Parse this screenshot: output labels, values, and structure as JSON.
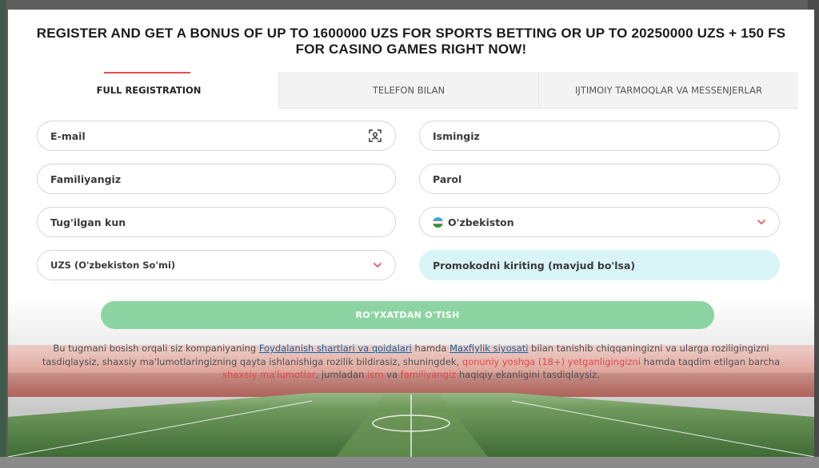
{
  "modal": {
    "title": "REGISTER AND GET A BONUS OF UP TO 1600000 UZS FOR SPORTS BETTING OR UP TO 20250000 UZS + 150 FS FOR CASINO GAMES RIGHT NOW!"
  },
  "tabs": [
    {
      "label": "FULL REGISTRATION",
      "active": true
    },
    {
      "label": "TELEFON BILAN",
      "active": false
    },
    {
      "label": "IJTIMOIY TARMOQLAR VA MESSENJERLAR",
      "active": false
    }
  ],
  "form": {
    "email_placeholder": "E-mail",
    "first_name_placeholder": "Ismingiz",
    "last_name_placeholder": "Familiyangiz",
    "password_placeholder": "Parol",
    "birthday_placeholder": "Tug'ilgan kun",
    "country_value": "O'zbekiston",
    "currency_value": "UZS (O'zbekiston So'mi)",
    "promo_placeholder": "Promokodni kiriting (mavjud bo'lsa)",
    "submit_label": "RO'YXATDAN O'TISH"
  },
  "legal": {
    "p1": "Bu tugmani bosish orqali siz kompaniyaning ",
    "terms_link": "Foydalanish shartlari va qoidalari",
    "p2": " hamda ",
    "privacy_link": "Maxfiylik siyosati",
    "p3": " bilan tanishib chiqqaningizni va ularga roziligingizni tasdiqlaysiz, shaxsiy ma'lumotlaringizning qayta ishlanishiga rozilik bildirasiz, shuningdek, ",
    "age_text": "qonuniy yoshga (18+) yetganligingizni",
    "p4": " hamda taqdim etilgan barcha ",
    "personal_data_text": "shaxsiy ma'lumotlar",
    "p5": ", jumladan ",
    "name_text": "ism",
    "p6": " va ",
    "surname_text": "familiyangiz",
    "p7": " haqiqiy ekanligini tasdiqlaysiz."
  },
  "colors": {
    "accent_red": "#e15151",
    "submit_green": "#8cd5a2",
    "promo_bg": "#d8f4f7",
    "link_blue": "#1a64a0"
  },
  "icons": {
    "email_field_icon": "face-scan-icon",
    "dropdown_icon": "chevron-down-icon",
    "country_flag": "uzbekistan-flag-icon"
  }
}
